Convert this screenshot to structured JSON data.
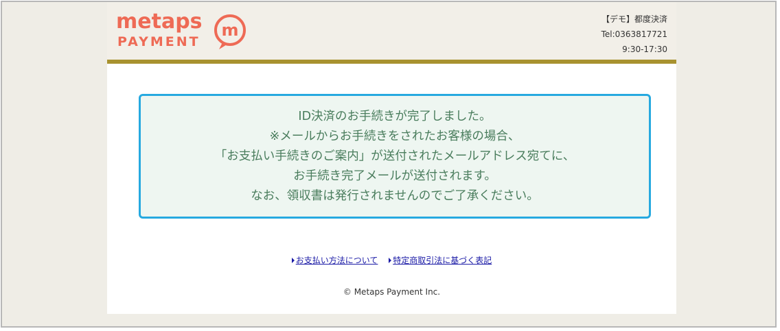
{
  "header": {
    "logo_top": "metaps",
    "logo_bottom": "PAYMENT",
    "logo_mark": "m",
    "shop_name": "【デモ】都度決済",
    "tel": "Tel:0363817721",
    "hours": "9:30-17:30"
  },
  "message": {
    "lines": [
      "ID決済のお手続きが完了しました。",
      "※メールからお手続きをされたお客様の場合、",
      "「お支払い手続きのご案内」が送付されたメールアドレス宛てに、",
      "お手続き完了メールが送付されます。",
      "なお、領収書は発行されませんのでご了承ください。"
    ]
  },
  "footer": {
    "links": [
      "お支払い方法について",
      "特定商取引法に基づく表記"
    ],
    "copyright": "© Metaps Payment Inc."
  },
  "colors": {
    "brand": "#ee6a55",
    "header_bar": "#a8922f",
    "message_border": "#26a9e0",
    "message_text": "#4a7d5d",
    "link": "#1a1aa6"
  }
}
